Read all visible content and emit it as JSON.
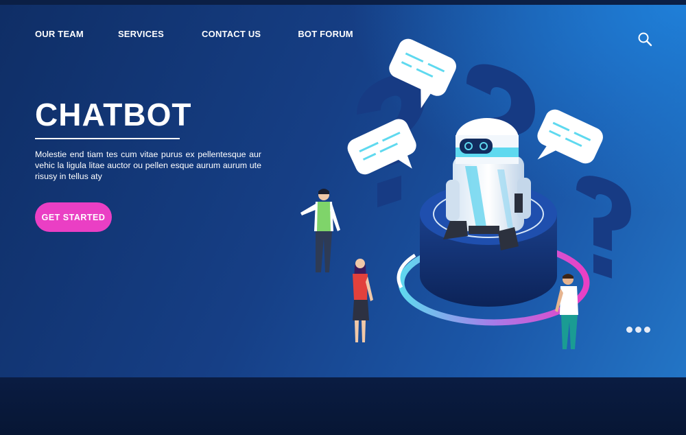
{
  "nav": {
    "items": [
      {
        "label": "OUR TEAM"
      },
      {
        "label": "SERVICES"
      },
      {
        "label": "CONTACT US"
      },
      {
        "label": "BOT FORUM"
      }
    ]
  },
  "header": {
    "search_icon": "search-icon"
  },
  "hero": {
    "title": "CHATBOT",
    "description": "Molestie end tiam tes cum vitae purus ex pellentesque aur vehic la ligula litae auctor ou pellen esque aurum aurum ute risusy in tellus aty",
    "cta_label": "GET STARTED"
  },
  "illustration": {
    "icons": [
      "chatbot-robot",
      "speech-bubble",
      "question-mark",
      "person"
    ]
  },
  "colors": {
    "accent": "#ea3fc4",
    "background": "#163f86",
    "cyan": "#5fd9ef",
    "text": "#ffffff"
  }
}
